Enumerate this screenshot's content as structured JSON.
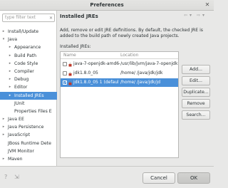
{
  "window": {
    "title": "Preferences",
    "close_glyph": "✕"
  },
  "filter": {
    "placeholder": "type filter text"
  },
  "tree": [
    {
      "label": "Install/Update",
      "arrow": "▸",
      "level": 0,
      "selected": false
    },
    {
      "label": "Java",
      "arrow": "▾",
      "level": 0,
      "selected": false
    },
    {
      "label": "Appearance",
      "arrow": "▸",
      "level": 1,
      "selected": false
    },
    {
      "label": "Build Path",
      "arrow": "▸",
      "level": 1,
      "selected": false
    },
    {
      "label": "Code Style",
      "arrow": "▸",
      "level": 1,
      "selected": false
    },
    {
      "label": "Compiler",
      "arrow": "▸",
      "level": 1,
      "selected": false
    },
    {
      "label": "Debug",
      "arrow": "▸",
      "level": 1,
      "selected": false
    },
    {
      "label": "Editor",
      "arrow": "▸",
      "level": 1,
      "selected": false
    },
    {
      "label": "Installed JREs",
      "arrow": "▸",
      "level": 1,
      "selected": true
    },
    {
      "label": "JUnit",
      "arrow": "",
      "level": 1,
      "selected": false
    },
    {
      "label": "Properties Files E",
      "arrow": "",
      "level": 1,
      "selected": false
    },
    {
      "label": "Java EE",
      "arrow": "▸",
      "level": 0,
      "selected": false
    },
    {
      "label": "Java Persistence",
      "arrow": "▸",
      "level": 0,
      "selected": false
    },
    {
      "label": "JavaScript",
      "arrow": "▸",
      "level": 0,
      "selected": false
    },
    {
      "label": "JBoss Runtime Dete",
      "arrow": "",
      "level": 0,
      "selected": false
    },
    {
      "label": "JVM Monitor",
      "arrow": "",
      "level": 0,
      "selected": false
    },
    {
      "label": "Maven",
      "arrow": "▸",
      "level": 0,
      "selected": false
    }
  ],
  "page": {
    "title": "Installed JREs",
    "nav": {
      "back": "⇦",
      "back_menu": "▾",
      "forward": "⇨",
      "forward_menu": "▾"
    },
    "description": "Add, remove or edit JRE definitions. By default, the checked JRE is added to the build path of newly created Java projects.",
    "installed_label": "Installed JREs:",
    "columns": {
      "name": "Name",
      "location": "Location"
    },
    "rows": [
      {
        "name": "java-7-openjdk-amd64",
        "location": "/usr/lib/jvm/java-7-openjdk",
        "checked": false,
        "selected": false
      },
      {
        "name": "jdk1.8.0_05",
        "location": "/home/        /java/jdk/jdk",
        "checked": false,
        "selected": false
      },
      {
        "name": "jdk1.8.0_05 1 (defaul",
        "location": "/home/        /java/jdk/jd",
        "checked": true,
        "selected": true
      }
    ]
  },
  "buttons": {
    "add": "Add...",
    "edit": "Edit...",
    "duplicate": "Duplicate...",
    "remove": "Remove",
    "search": "Search..."
  },
  "footer": {
    "help_icon": "?",
    "import_icon": "⇲",
    "cancel": "Cancel",
    "ok": "OK"
  },
  "colors": {
    "selection": "#4a90d9",
    "jre_icon": "#c0392b"
  }
}
